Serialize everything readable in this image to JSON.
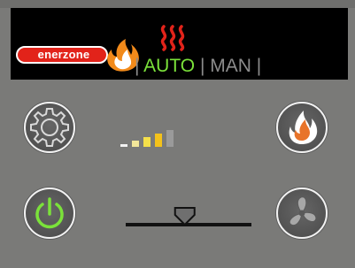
{
  "header": {
    "brand": "enerzone",
    "separator": "|",
    "mode_auto": "AUTO",
    "mode_man": "MAN",
    "active_mode": "AUTO",
    "heat_icon": "heat-waves-icon"
  },
  "controls": {
    "settings_icon": "gear-icon",
    "power_icon": "power-icon",
    "flame_icon": "flame-icon",
    "fan_icon": "fan-icon",
    "power_level": 4,
    "power_level_max": 5,
    "fan_speed_fraction": 0.47
  },
  "colors": {
    "accent_green": "#7be23a",
    "brand_red": "#e2231a",
    "header_bg": "#000000",
    "panel_bg": "#7a7a78"
  }
}
